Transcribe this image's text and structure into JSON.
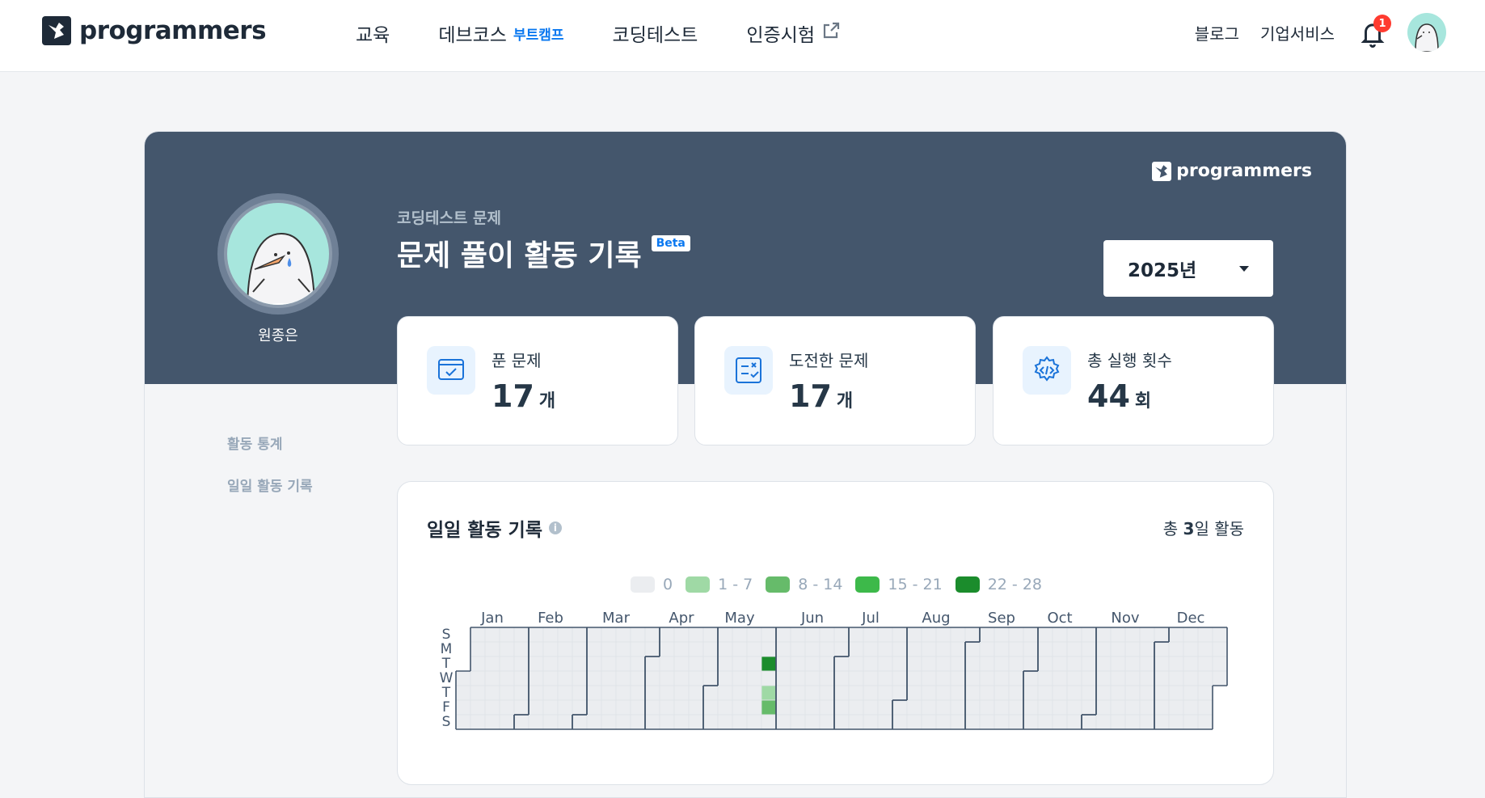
{
  "header": {
    "logo_text": "programmers",
    "nav": [
      {
        "label": "교육"
      },
      {
        "label": "데브코스",
        "badge": "부트캠프"
      },
      {
        "label": "코딩테스트"
      },
      {
        "label": "인증시험",
        "external": true
      }
    ],
    "right_links": [
      "블로그",
      "기업서비스"
    ],
    "notification_count": "1"
  },
  "profile": {
    "name": "원종은",
    "sub_label": "코딩테스트 문제",
    "title": "문제 풀이 활동 기록",
    "beta_badge": "Beta",
    "banner_logo_text": "programmers",
    "year": "2025년"
  },
  "stats": [
    {
      "label": "푼 문제",
      "value": "17",
      "unit": "개",
      "icon": "solved-icon"
    },
    {
      "label": "도전한 문제",
      "value": "17",
      "unit": "개",
      "icon": "challenge-icon"
    },
    {
      "label": "총 실행 횟수",
      "value": "44",
      "unit": "회",
      "icon": "gear-code-icon"
    }
  ],
  "side_menu": [
    "활동 통계",
    "일일 활동 기록"
  ],
  "activity": {
    "title": "일일 활동 기록",
    "total_prefix": "총 ",
    "total_days": "3",
    "total_suffix": "일 활동",
    "legend": [
      {
        "label": "0",
        "color": "#ebedf0"
      },
      {
        "label": "1 - 7",
        "color": "#9fd9a5"
      },
      {
        "label": "8 - 14",
        "color": "#66bb6a"
      },
      {
        "label": "15 - 21",
        "color": "#3db94a"
      },
      {
        "label": "22 - 28",
        "color": "#1b8c2c"
      }
    ],
    "months": [
      "Jan",
      "Feb",
      "Mar",
      "Apr",
      "May",
      "Jun",
      "Jul",
      "Aug",
      "Sep",
      "Oct",
      "Nov",
      "Dec"
    ],
    "weekdays": [
      "S",
      "M",
      "T",
      "W",
      "T",
      "F",
      "S"
    ],
    "year": 2025,
    "active_days": [
      {
        "date": "2025-05-27",
        "level": 4
      },
      {
        "date": "2025-05-29",
        "level": 1
      },
      {
        "date": "2025-05-30",
        "level": 2
      }
    ]
  }
}
